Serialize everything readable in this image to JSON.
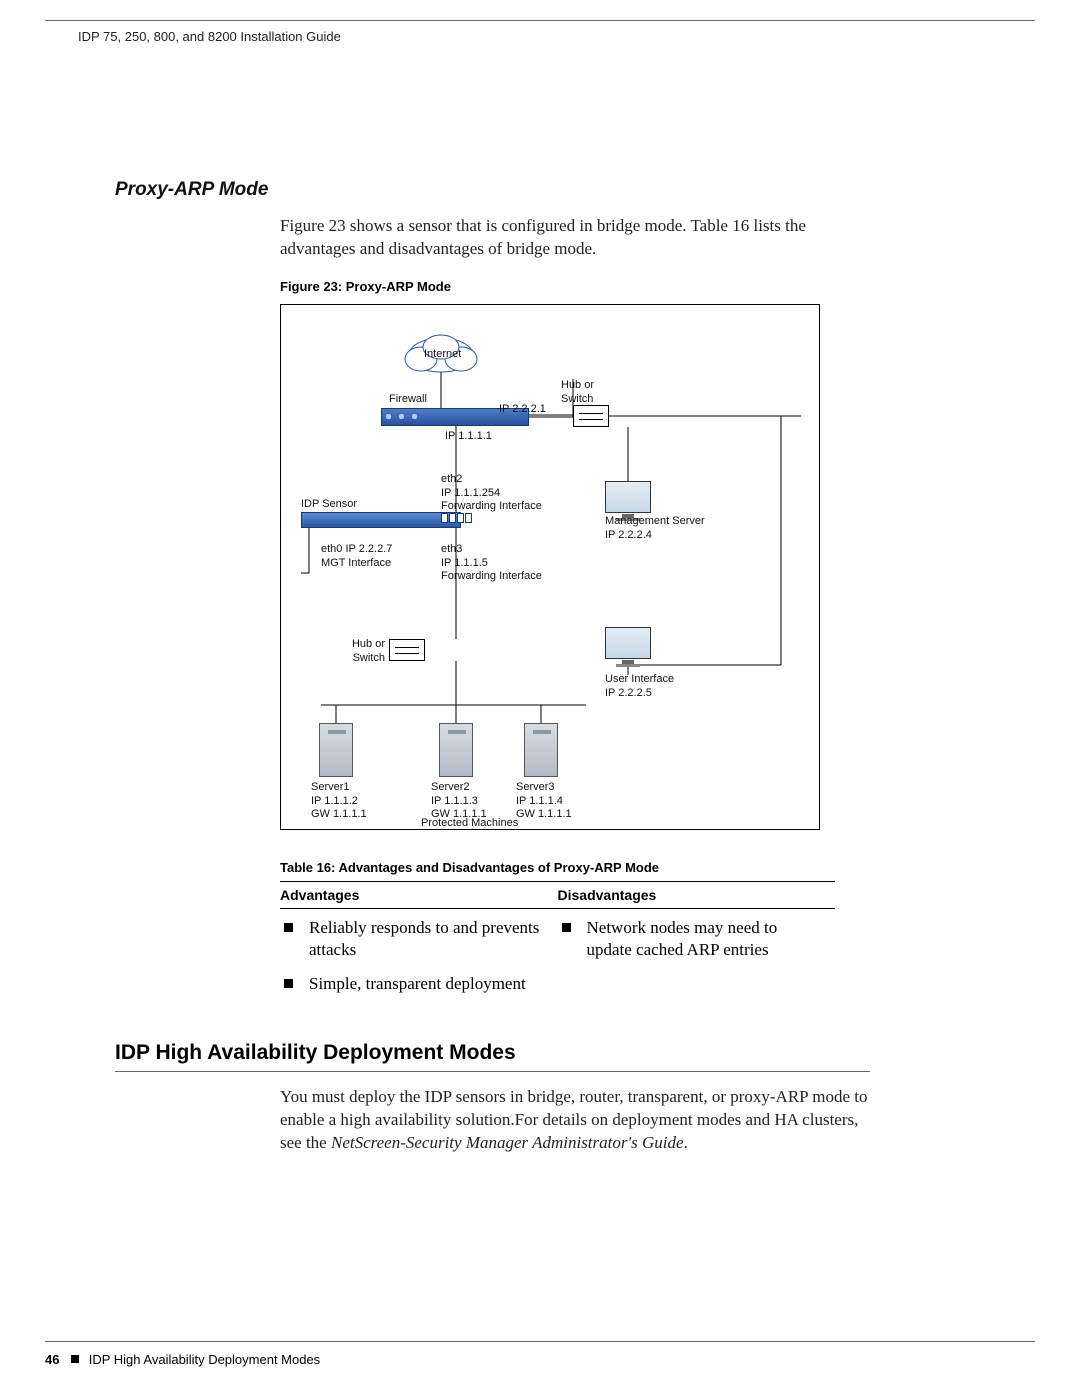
{
  "header": "IDP 75, 250, 800, and 8200 Installation Guide",
  "section1": {
    "title": "Proxy-ARP Mode",
    "intro": "Figure 23 shows a sensor that is configured in bridge mode. Table 16 lists the advantages and disadvantages of bridge mode.",
    "figure_caption": "Figure 23:  Proxy-ARP Mode"
  },
  "diagram": {
    "internet": "Internet",
    "firewall": "Firewall",
    "ip_out": "IP 2.2.2.1",
    "hub_r": "Hub or\nSwitch",
    "ip_in": "IP 1.1.1.1",
    "eth2": "eth2\nIP 1.1.1.254\nForwarding Interface",
    "idp": "IDP Sensor",
    "mgmt_srv": "Management Server\nIP 2.2.2.4",
    "eth0": "eth0 IP 2.2.2.7\nMGT Interface",
    "eth3": "eth3\nIP 1.1.1.5\nForwarding Interface",
    "hub_b": "Hub or\nSwitch",
    "ui": "User Interface\nIP 2.2.2.5",
    "s1": "Server1\nIP 1.1.1.2\nGW 1.1.1.1",
    "s2": "Server2\nIP 1.1.1.3\nGW 1.1.1.1",
    "s3": "Server3\nIP 1.1.1.4\nGW 1.1.1.1",
    "protected": "Protected Machines"
  },
  "table": {
    "caption": "Table 16:  Advantages and Disadvantages of Proxy-ARP Mode",
    "h_adv": "Advantages",
    "h_dis": "Disadvantages",
    "adv1": "Reliably responds to and prevents attacks",
    "adv2": "Simple, transparent deployment",
    "dis1": "Network nodes may need to update cached ARP entries"
  },
  "section2": {
    "title": "IDP High Availability Deployment Modes",
    "p1a": "You must deploy the IDP sensors in bridge, router, transparent, or proxy-ARP mode to enable a high availability solution.For details on deployment modes and HA clusters, see the ",
    "p1i": "NetScreen-Security Manager Administrator's Guide",
    "p1b": "."
  },
  "footer": {
    "page": "46",
    "label": "IDP High Availability Deployment Modes"
  }
}
